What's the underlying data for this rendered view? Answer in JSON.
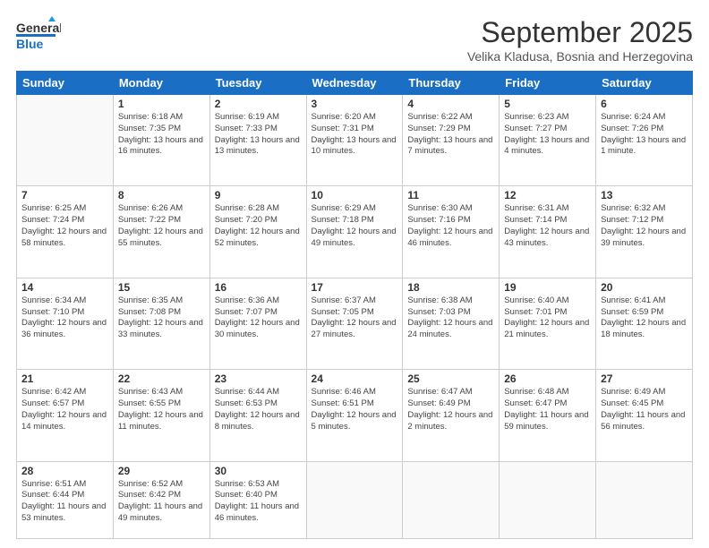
{
  "header": {
    "logo_line1": "General",
    "logo_line2": "Blue",
    "month": "September 2025",
    "location": "Velika Kladusa, Bosnia and Herzegovina"
  },
  "days_of_week": [
    "Sunday",
    "Monday",
    "Tuesday",
    "Wednesday",
    "Thursday",
    "Friday",
    "Saturday"
  ],
  "weeks": [
    [
      {
        "day": "",
        "sunrise": "",
        "sunset": "",
        "daylight": ""
      },
      {
        "day": "1",
        "sunrise": "Sunrise: 6:18 AM",
        "sunset": "Sunset: 7:35 PM",
        "daylight": "Daylight: 13 hours and 16 minutes."
      },
      {
        "day": "2",
        "sunrise": "Sunrise: 6:19 AM",
        "sunset": "Sunset: 7:33 PM",
        "daylight": "Daylight: 13 hours and 13 minutes."
      },
      {
        "day": "3",
        "sunrise": "Sunrise: 6:20 AM",
        "sunset": "Sunset: 7:31 PM",
        "daylight": "Daylight: 13 hours and 10 minutes."
      },
      {
        "day": "4",
        "sunrise": "Sunrise: 6:22 AM",
        "sunset": "Sunset: 7:29 PM",
        "daylight": "Daylight: 13 hours and 7 minutes."
      },
      {
        "day": "5",
        "sunrise": "Sunrise: 6:23 AM",
        "sunset": "Sunset: 7:27 PM",
        "daylight": "Daylight: 13 hours and 4 minutes."
      },
      {
        "day": "6",
        "sunrise": "Sunrise: 6:24 AM",
        "sunset": "Sunset: 7:26 PM",
        "daylight": "Daylight: 13 hours and 1 minute."
      }
    ],
    [
      {
        "day": "7",
        "sunrise": "Sunrise: 6:25 AM",
        "sunset": "Sunset: 7:24 PM",
        "daylight": "Daylight: 12 hours and 58 minutes."
      },
      {
        "day": "8",
        "sunrise": "Sunrise: 6:26 AM",
        "sunset": "Sunset: 7:22 PM",
        "daylight": "Daylight: 12 hours and 55 minutes."
      },
      {
        "day": "9",
        "sunrise": "Sunrise: 6:28 AM",
        "sunset": "Sunset: 7:20 PM",
        "daylight": "Daylight: 12 hours and 52 minutes."
      },
      {
        "day": "10",
        "sunrise": "Sunrise: 6:29 AM",
        "sunset": "Sunset: 7:18 PM",
        "daylight": "Daylight: 12 hours and 49 minutes."
      },
      {
        "day": "11",
        "sunrise": "Sunrise: 6:30 AM",
        "sunset": "Sunset: 7:16 PM",
        "daylight": "Daylight: 12 hours and 46 minutes."
      },
      {
        "day": "12",
        "sunrise": "Sunrise: 6:31 AM",
        "sunset": "Sunset: 7:14 PM",
        "daylight": "Daylight: 12 hours and 43 minutes."
      },
      {
        "day": "13",
        "sunrise": "Sunrise: 6:32 AM",
        "sunset": "Sunset: 7:12 PM",
        "daylight": "Daylight: 12 hours and 39 minutes."
      }
    ],
    [
      {
        "day": "14",
        "sunrise": "Sunrise: 6:34 AM",
        "sunset": "Sunset: 7:10 PM",
        "daylight": "Daylight: 12 hours and 36 minutes."
      },
      {
        "day": "15",
        "sunrise": "Sunrise: 6:35 AM",
        "sunset": "Sunset: 7:08 PM",
        "daylight": "Daylight: 12 hours and 33 minutes."
      },
      {
        "day": "16",
        "sunrise": "Sunrise: 6:36 AM",
        "sunset": "Sunset: 7:07 PM",
        "daylight": "Daylight: 12 hours and 30 minutes."
      },
      {
        "day": "17",
        "sunrise": "Sunrise: 6:37 AM",
        "sunset": "Sunset: 7:05 PM",
        "daylight": "Daylight: 12 hours and 27 minutes."
      },
      {
        "day": "18",
        "sunrise": "Sunrise: 6:38 AM",
        "sunset": "Sunset: 7:03 PM",
        "daylight": "Daylight: 12 hours and 24 minutes."
      },
      {
        "day": "19",
        "sunrise": "Sunrise: 6:40 AM",
        "sunset": "Sunset: 7:01 PM",
        "daylight": "Daylight: 12 hours and 21 minutes."
      },
      {
        "day": "20",
        "sunrise": "Sunrise: 6:41 AM",
        "sunset": "Sunset: 6:59 PM",
        "daylight": "Daylight: 12 hours and 18 minutes."
      }
    ],
    [
      {
        "day": "21",
        "sunrise": "Sunrise: 6:42 AM",
        "sunset": "Sunset: 6:57 PM",
        "daylight": "Daylight: 12 hours and 14 minutes."
      },
      {
        "day": "22",
        "sunrise": "Sunrise: 6:43 AM",
        "sunset": "Sunset: 6:55 PM",
        "daylight": "Daylight: 12 hours and 11 minutes."
      },
      {
        "day": "23",
        "sunrise": "Sunrise: 6:44 AM",
        "sunset": "Sunset: 6:53 PM",
        "daylight": "Daylight: 12 hours and 8 minutes."
      },
      {
        "day": "24",
        "sunrise": "Sunrise: 6:46 AM",
        "sunset": "Sunset: 6:51 PM",
        "daylight": "Daylight: 12 hours and 5 minutes."
      },
      {
        "day": "25",
        "sunrise": "Sunrise: 6:47 AM",
        "sunset": "Sunset: 6:49 PM",
        "daylight": "Daylight: 12 hours and 2 minutes."
      },
      {
        "day": "26",
        "sunrise": "Sunrise: 6:48 AM",
        "sunset": "Sunset: 6:47 PM",
        "daylight": "Daylight: 11 hours and 59 minutes."
      },
      {
        "day": "27",
        "sunrise": "Sunrise: 6:49 AM",
        "sunset": "Sunset: 6:45 PM",
        "daylight": "Daylight: 11 hours and 56 minutes."
      }
    ],
    [
      {
        "day": "28",
        "sunrise": "Sunrise: 6:51 AM",
        "sunset": "Sunset: 6:44 PM",
        "daylight": "Daylight: 11 hours and 53 minutes."
      },
      {
        "day": "29",
        "sunrise": "Sunrise: 6:52 AM",
        "sunset": "Sunset: 6:42 PM",
        "daylight": "Daylight: 11 hours and 49 minutes."
      },
      {
        "day": "30",
        "sunrise": "Sunrise: 6:53 AM",
        "sunset": "Sunset: 6:40 PM",
        "daylight": "Daylight: 11 hours and 46 minutes."
      },
      {
        "day": "",
        "sunrise": "",
        "sunset": "",
        "daylight": ""
      },
      {
        "day": "",
        "sunrise": "",
        "sunset": "",
        "daylight": ""
      },
      {
        "day": "",
        "sunrise": "",
        "sunset": "",
        "daylight": ""
      },
      {
        "day": "",
        "sunrise": "",
        "sunset": "",
        "daylight": ""
      }
    ]
  ]
}
